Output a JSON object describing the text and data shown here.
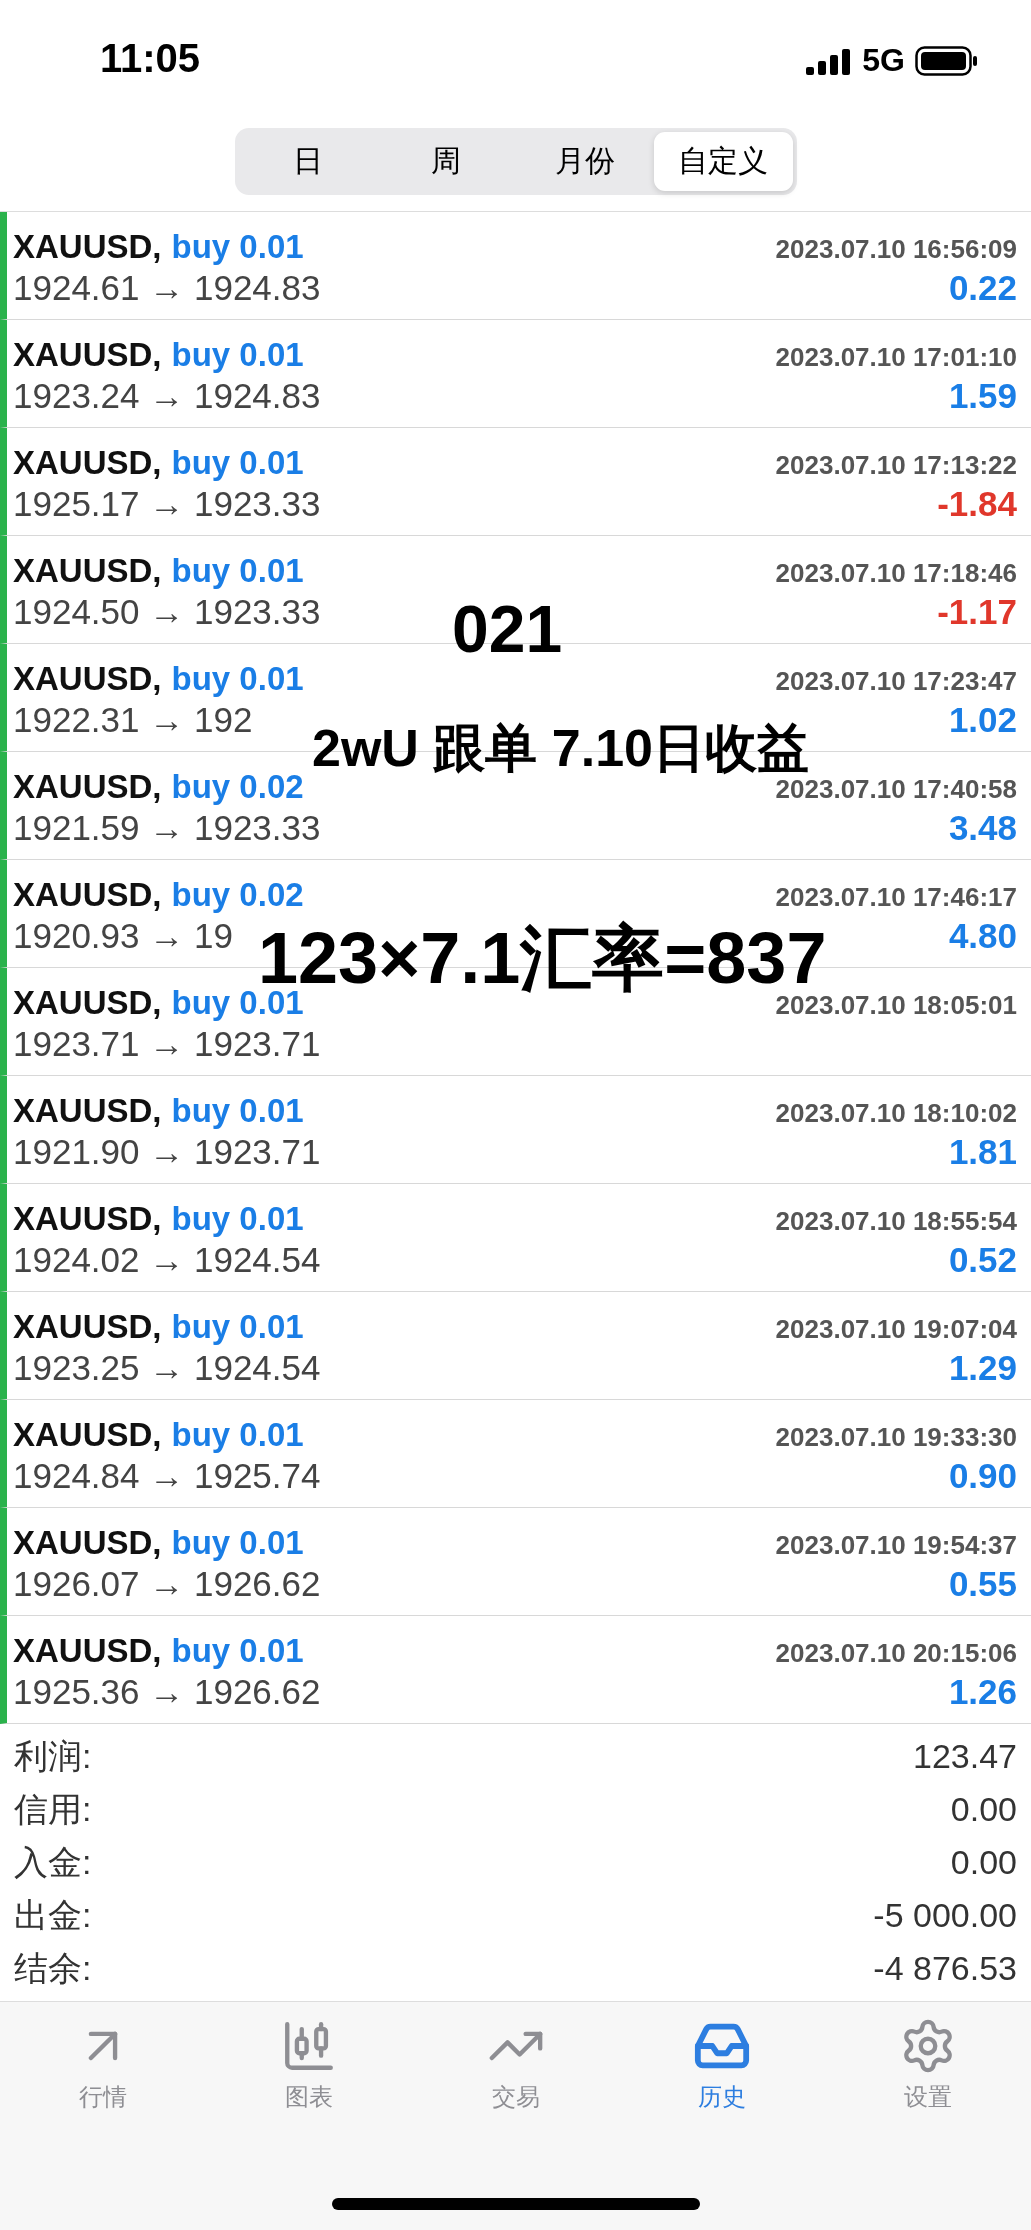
{
  "status_bar": {
    "time": "11:05",
    "network": "5G"
  },
  "periods": [
    {
      "label": "日",
      "selected": false
    },
    {
      "label": "周",
      "selected": false
    },
    {
      "label": "月份",
      "selected": false
    },
    {
      "label": "自定义",
      "selected": true
    }
  ],
  "deals": [
    {
      "symbol": "XAUUSD,",
      "type": "buy 0.01",
      "time": "2023.07.10 16:56:09",
      "prices": "1924.61 → 1924.83",
      "profit": "0.22",
      "color": "#1a7ee6"
    },
    {
      "symbol": "XAUUSD,",
      "type": "buy 0.01",
      "time": "2023.07.10 17:01:10",
      "prices": "1923.24 → 1924.83",
      "profit": "1.59",
      "color": "#1a7ee6"
    },
    {
      "symbol": "XAUUSD,",
      "type": "buy 0.01",
      "time": "2023.07.10 17:13:22",
      "prices": "1925.17 → 1923.33",
      "profit": "-1.84",
      "color": "#e0372b"
    },
    {
      "symbol": "XAUUSD,",
      "type": "buy 0.01",
      "time": "2023.07.10 17:18:46",
      "prices": "1924.50 → 1923.33",
      "profit": "-1.17",
      "color": "#e0372b"
    },
    {
      "symbol": "XAUUSD,",
      "type": "buy 0.01",
      "time": "2023.07.10 17:23:47",
      "prices": "1922.31 → 192",
      "profit": "1.02",
      "color": "#1a7ee6"
    },
    {
      "symbol": "XAUUSD,",
      "type": "buy 0.02",
      "time": "2023.07.10 17:40:58",
      "prices": "1921.59 → 1923.33",
      "profit": "3.48",
      "color": "#1a7ee6"
    },
    {
      "symbol": "XAUUSD,",
      "type": "buy 0.02",
      "time": "2023.07.10 17:46:17",
      "prices": "1920.93 → 19",
      "profit": "4.80",
      "color": "#1a7ee6"
    },
    {
      "symbol": "XAUUSD,",
      "type": "buy 0.01",
      "time": "2023.07.10 18:05:01",
      "prices": "1923.71 → 1923.71"
    },
    {
      "symbol": "XAUUSD,",
      "type": "buy 0.01",
      "time": "2023.07.10 18:10:02",
      "prices": "1921.90 → 1923.71",
      "profit": "1.81",
      "color": "#1a7ee6"
    },
    {
      "symbol": "XAUUSD,",
      "type": "buy 0.01",
      "time": "2023.07.10 18:55:54",
      "prices": "1924.02 → 1924.54",
      "profit": "0.52",
      "color": "#1a7ee6"
    },
    {
      "symbol": "XAUUSD,",
      "type": "buy 0.01",
      "time": "2023.07.10 19:07:04",
      "prices": "1923.25 → 1924.54",
      "profit": "1.29",
      "color": "#1a7ee6"
    },
    {
      "symbol": "XAUUSD,",
      "type": "buy 0.01",
      "time": "2023.07.10 19:33:30",
      "prices": "1924.84 → 1925.74",
      "profit": "0.90",
      "color": "#1a7ee6"
    },
    {
      "symbol": "XAUUSD,",
      "type": "buy 0.01",
      "time": "2023.07.10 19:54:37",
      "prices": "1926.07 → 1926.62",
      "profit": "0.55",
      "color": "#1a7ee6"
    },
    {
      "symbol": "XAUUSD,",
      "type": "buy 0.01",
      "time": "2023.07.10 20:15:06",
      "prices": "1925.36 → 1926.62",
      "profit": "1.26",
      "color": "#1a7ee6"
    }
  ],
  "annotations": [
    "021",
    "2wU 跟单 7.10日收益",
    "123×7.1汇率=837"
  ],
  "summary": [
    {
      "label": "利润:",
      "value": "123.47"
    },
    {
      "label": "信用:",
      "value": "0.00"
    },
    {
      "label": "入金:",
      "value": "0.00"
    },
    {
      "label": "出金:",
      "value": "-5 000.00"
    },
    {
      "label": "结余:",
      "value": "-4 876.53"
    }
  ],
  "tab_bar": [
    {
      "label": "行情",
      "selected": false
    },
    {
      "label": "图表",
      "selected": false
    },
    {
      "label": "交易",
      "selected": false
    },
    {
      "label": "历史",
      "selected": true
    },
    {
      "label": "设置",
      "selected": false
    }
  ]
}
